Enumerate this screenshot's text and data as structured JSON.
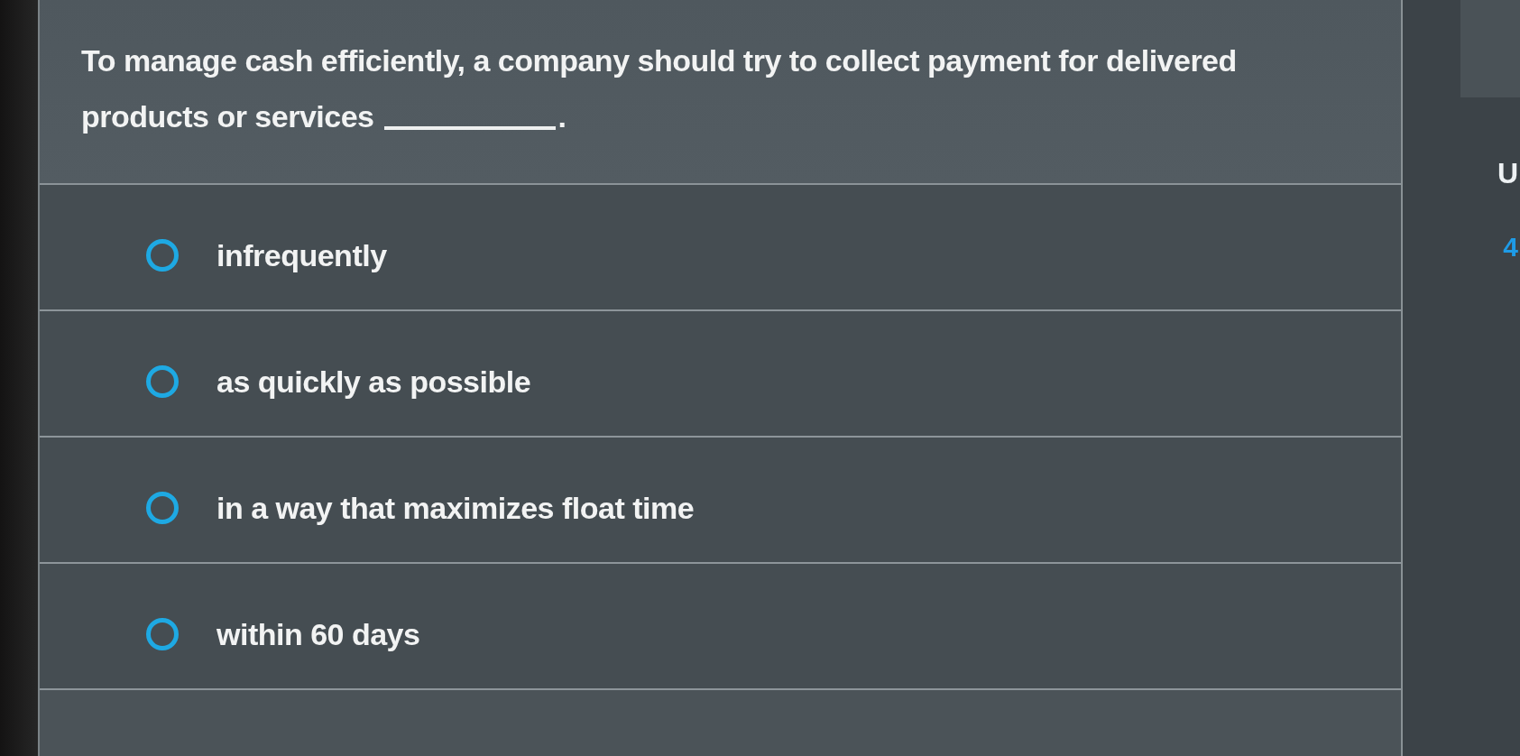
{
  "question": {
    "text": "To manage cash efficiently, a company should try to collect payment for delivered products or services",
    "after_blank": "."
  },
  "options": [
    {
      "label": "infrequently",
      "selected": false
    },
    {
      "label": "as quickly as possible",
      "selected": false
    },
    {
      "label": "in a way that maximizes float time",
      "selected": false
    },
    {
      "label": "within 60 days",
      "selected": false
    }
  ],
  "side": {
    "letter": "U",
    "number": "4"
  }
}
